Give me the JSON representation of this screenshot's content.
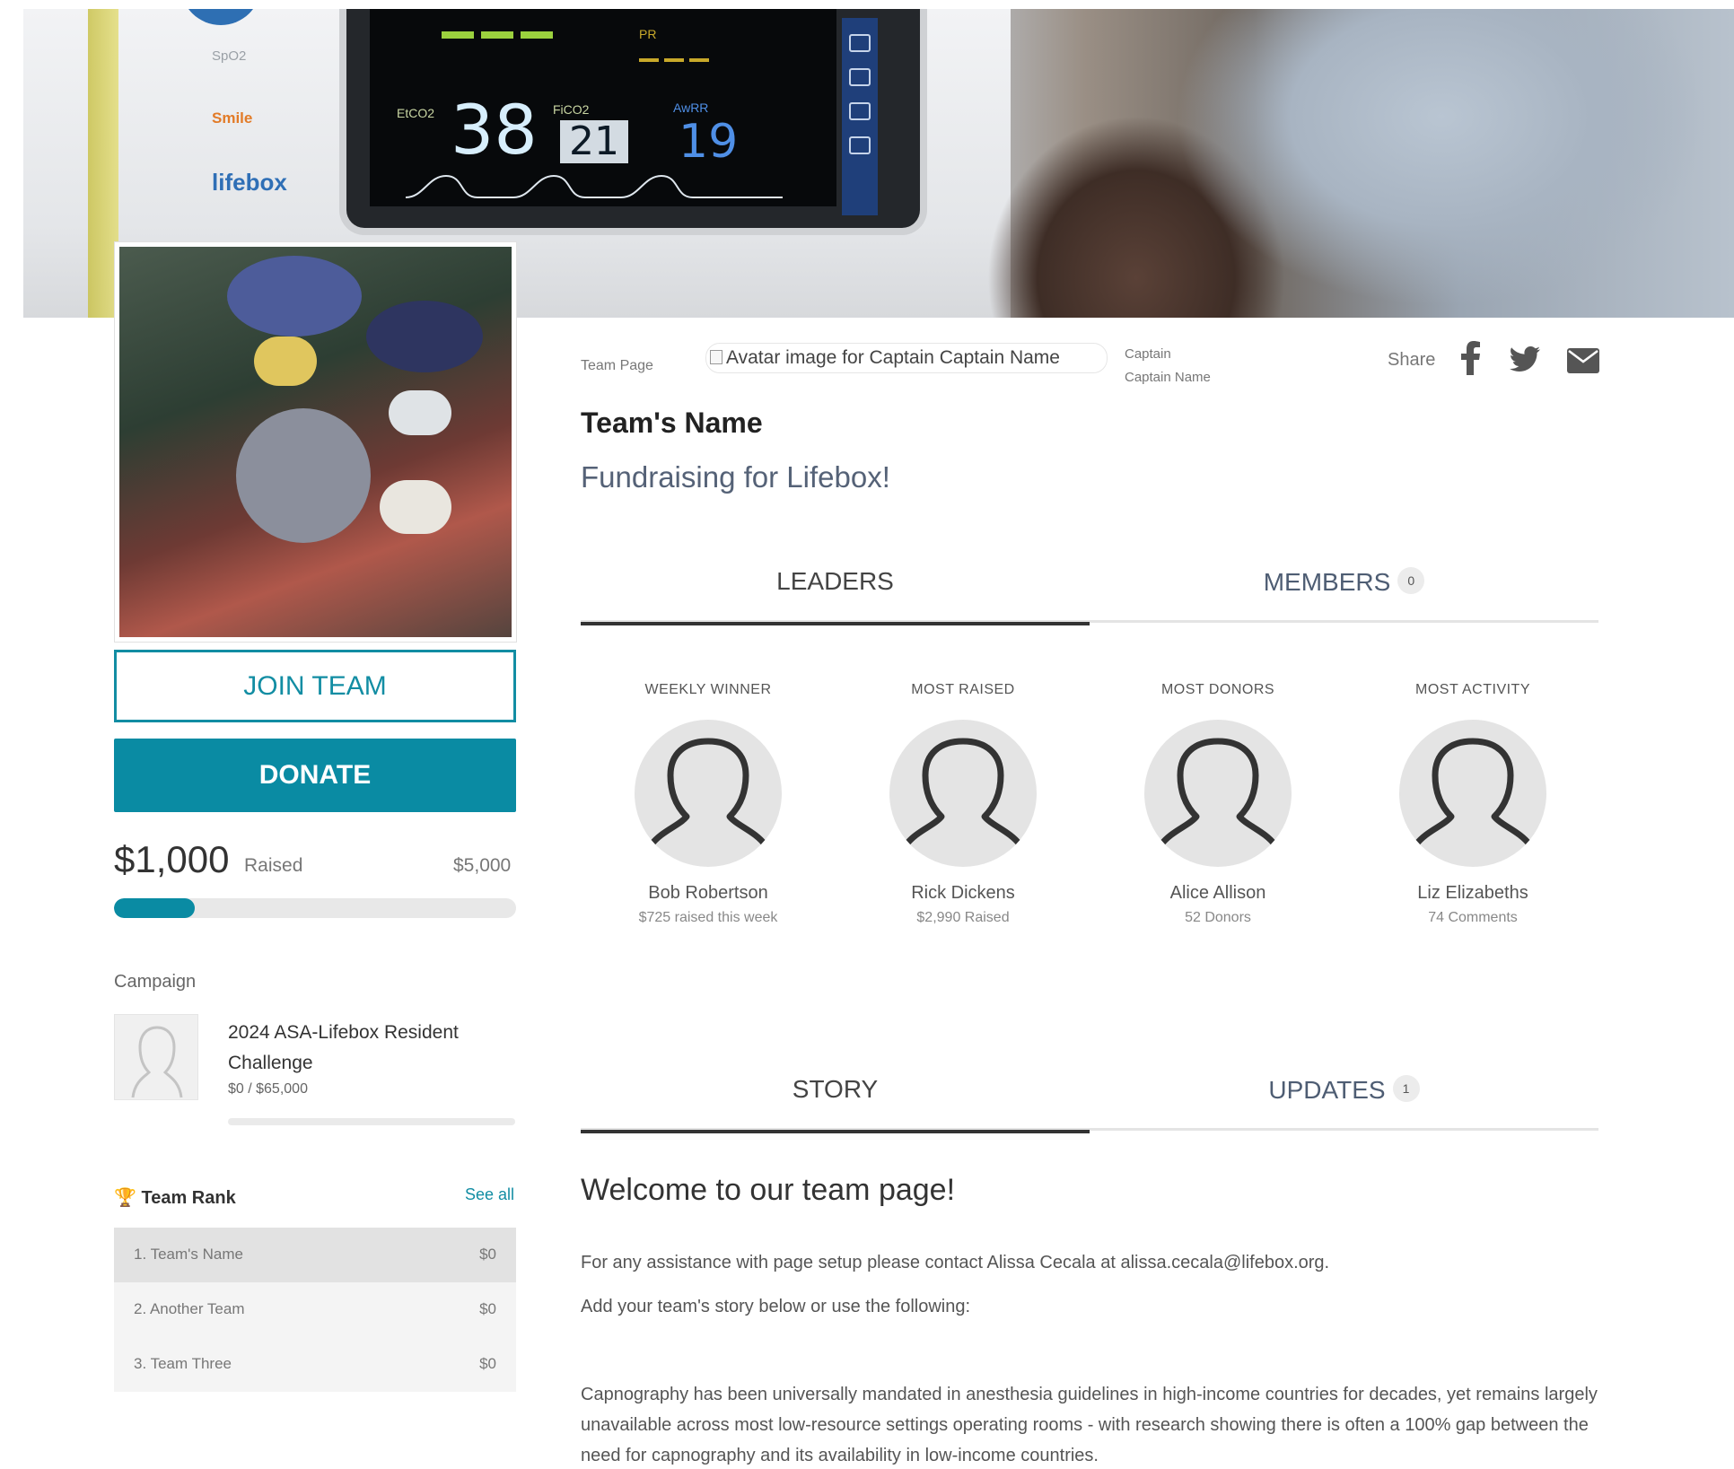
{
  "team_page_label": "Team Page",
  "avatar_alt": "Avatar image for Captain Captain Name",
  "captain": {
    "label": "Captain",
    "name": "Captain Name"
  },
  "share": {
    "label": "Share",
    "icons": [
      "facebook-icon",
      "twitter-icon",
      "email-icon"
    ]
  },
  "team_name": "Team's Name",
  "subtitle": "Fundraising for Lifebox!",
  "buttons": {
    "join": "JOIN TEAM",
    "donate": "DONATE"
  },
  "fundraising": {
    "raised": "$1,000",
    "raised_label": "Raised",
    "goal": "$5,000",
    "progress_fraction": 0.2
  },
  "campaign": {
    "heading": "Campaign",
    "name": "2024 ASA-Lifebox Resident Challenge",
    "amount": "$0 / $65,000"
  },
  "team_rank": {
    "heading": "Team Rank",
    "see_all": "See all",
    "rows": [
      {
        "name": "1. Team's Name",
        "amount": "$0"
      },
      {
        "name": "2. Another Team",
        "amount": "$0"
      },
      {
        "name": "3. Team Three",
        "amount": "$0"
      }
    ]
  },
  "tabs_top": {
    "leaders": "LEADERS",
    "members": "MEMBERS",
    "members_count": "0"
  },
  "leaders": [
    {
      "category": "WEEKLY WINNER",
      "name": "Bob Robertson",
      "stat": "$725 raised this week"
    },
    {
      "category": "MOST RAISED",
      "name": "Rick Dickens",
      "stat": "$2,990 Raised"
    },
    {
      "category": "MOST DONORS",
      "name": "Alice Allison",
      "stat": "52 Donors"
    },
    {
      "category": "MOST ACTIVITY",
      "name": "Liz Elizabeths",
      "stat": "74 Comments"
    }
  ],
  "tabs_bottom": {
    "story": "STORY",
    "updates": "UPDATES",
    "updates_count": "1"
  },
  "story": {
    "heading": "Welcome to our team page!",
    "p1": "For any assistance with page setup please contact Alissa Cecala at alissa.cecala@lifebox.org.",
    "p2": "Add your team's story below or use the following:",
    "p3": "Capnography has been universally mandated in anesthesia guidelines in high-income countries for decades, yet remains largely unavailable across most low-resource settings operating rooms - with research showing there is often a 100% gap between the need for capnography and its availability in low-income countries."
  },
  "hero_monitor": {
    "etco2": "38",
    "fico2": "21",
    "awrr": "19",
    "labels": {
      "etco2": "EtCO2",
      "fico2": "FiCO2",
      "awrr": "AwRR",
      "pr": "PR",
      "spo": "SpO2",
      "smile": "Smile",
      "brand": "lifebox"
    }
  },
  "colors": {
    "accent": "#0a8ba3",
    "text": "#333333",
    "muted": "#777777"
  }
}
